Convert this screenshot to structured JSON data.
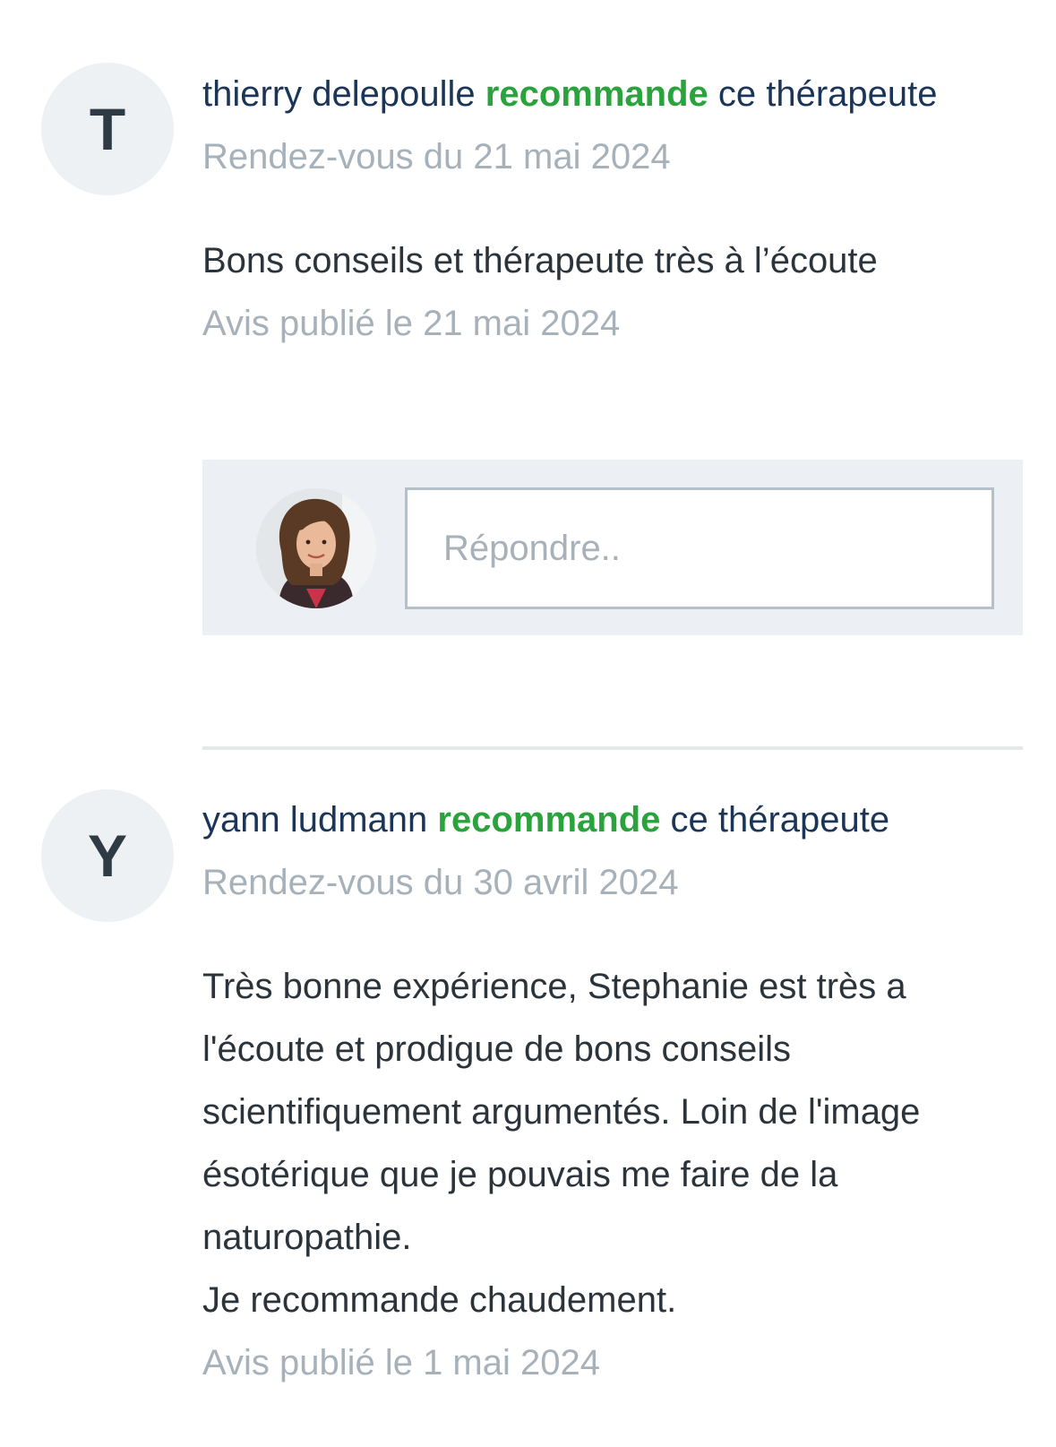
{
  "reviews": [
    {
      "initial": "T",
      "author": "thierry delepoulle",
      "recommend_word": "recommande",
      "recommend_suffix": " ce thérapeute",
      "appointment": "Rendez-vous du 21 mai 2024",
      "text": "Bons conseils et thérapeute très à l’écoute",
      "published": "Avis publié le 21 mai 2024",
      "reply_placeholder": "Répondre.."
    },
    {
      "initial": "Y",
      "author": "yann ludmann",
      "recommend_word": "recommande",
      "recommend_suffix": " ce thérapeute",
      "appointment": "Rendez-vous du 30 avril 2024",
      "text": "Très bonne expérience, Stephanie est très a l'écoute et prodigue de bons conseils scientifiquement argumentés. Loin de l'image ésotérique que je pouvais me faire de la naturopathie.\nJe recommande chaudement.",
      "published": "Avis publié le 1 mai 2024"
    }
  ],
  "colors": {
    "name": "#1a3558",
    "recommend": "#2aa33c",
    "muted": "#a7b1ba",
    "reply_bg": "#ecf0f4"
  }
}
